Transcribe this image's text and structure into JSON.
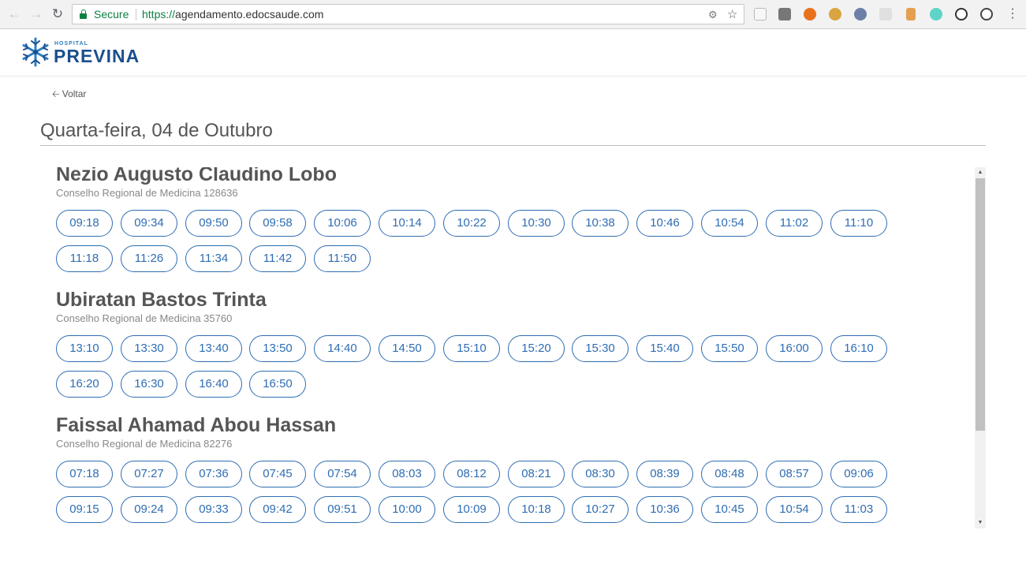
{
  "browser": {
    "secure_label": "Secure",
    "url_scheme": "https://",
    "url_host": "agendamento.edocsaude.com"
  },
  "site": {
    "logo_small": "HOSPITAL",
    "logo_big": "PREVINA"
  },
  "page": {
    "back_label": "Voltar",
    "date_title": "Quarta-feira, 04 de Outubro"
  },
  "doctors": [
    {
      "name": "Nezio Augusto Claudino Lobo",
      "crm": "Conselho Regional de Medicina 128636",
      "slots": [
        "09:18",
        "09:34",
        "09:50",
        "09:58",
        "10:06",
        "10:14",
        "10:22",
        "10:30",
        "10:38",
        "10:46",
        "10:54",
        "11:02",
        "11:10",
        "11:18",
        "11:26",
        "11:34",
        "11:42",
        "11:50"
      ]
    },
    {
      "name": "Ubiratan Bastos Trinta",
      "crm": "Conselho Regional de Medicina 35760",
      "slots": [
        "13:10",
        "13:30",
        "13:40",
        "13:50",
        "14:40",
        "14:50",
        "15:10",
        "15:20",
        "15:30",
        "15:40",
        "15:50",
        "16:00",
        "16:10",
        "16:20",
        "16:30",
        "16:40",
        "16:50"
      ]
    },
    {
      "name": "Faissal Ahamad Abou Hassan",
      "crm": "Conselho Regional de Medicina 82276",
      "slots": [
        "07:18",
        "07:27",
        "07:36",
        "07:45",
        "07:54",
        "08:03",
        "08:12",
        "08:21",
        "08:30",
        "08:39",
        "08:48",
        "08:57",
        "09:06",
        "09:15",
        "09:24",
        "09:33",
        "09:42",
        "09:51",
        "10:00",
        "10:09",
        "10:18",
        "10:27",
        "10:36",
        "10:45",
        "10:54",
        "11:03"
      ]
    }
  ],
  "colors": {
    "accent": "#2f6db3",
    "secure_green": "#0b8043",
    "logo_blue": "#1b4f8c"
  }
}
